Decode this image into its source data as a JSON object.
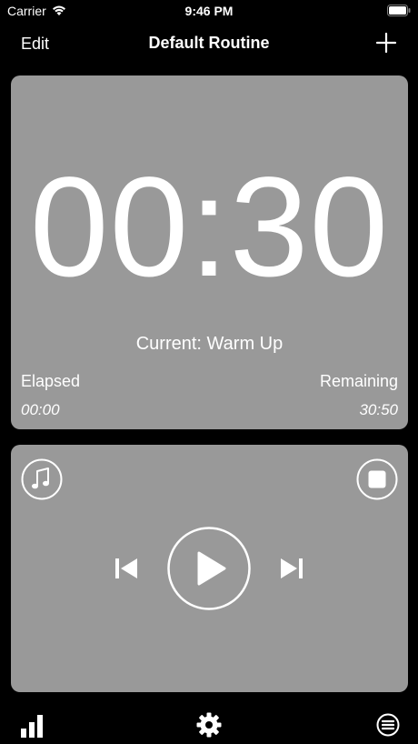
{
  "status_bar": {
    "carrier": "Carrier",
    "time": "9:46 PM",
    "icons": [
      "wifi-icon",
      "battery-icon"
    ]
  },
  "nav": {
    "edit_label": "Edit",
    "title": "Default Routine",
    "add_icon": "plus-icon"
  },
  "timer": {
    "display": "00:30",
    "current": "Current: Warm Up",
    "elapsed_label": "Elapsed",
    "elapsed_value": "00:00",
    "remaining_label": "Remaining",
    "remaining_value": "30:50"
  },
  "controls": {
    "icons": [
      "music-note-icon",
      "stop-icon",
      "skip-previous-icon",
      "play-icon",
      "skip-next-icon"
    ]
  },
  "tab_bar": {
    "icons": [
      "bar-chart-icon",
      "gear-icon",
      "list-icon"
    ]
  },
  "colors": {
    "background": "#000000",
    "card": "#999999",
    "foreground": "#ffffff"
  }
}
